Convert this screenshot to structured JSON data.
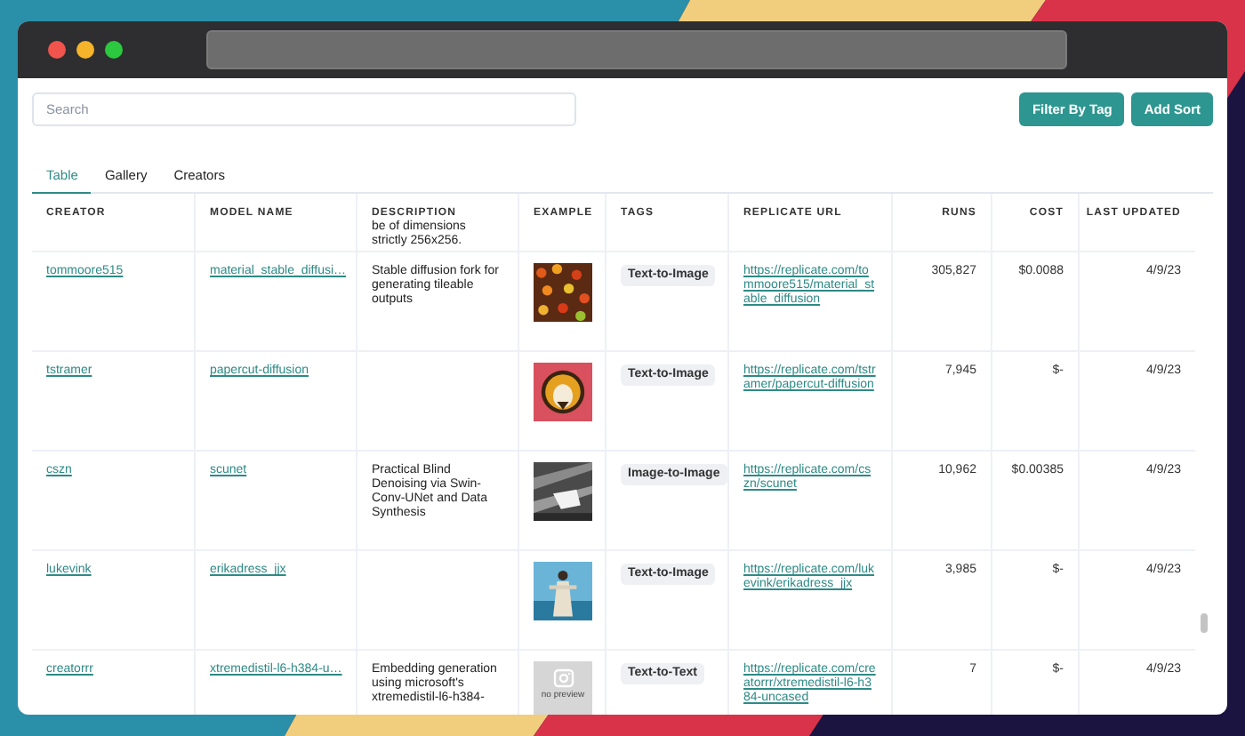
{
  "search": {
    "placeholder": "Search"
  },
  "buttons": [
    "Filter By Tag",
    "Add Sort"
  ],
  "tabs": [
    {
      "label": "Table",
      "selected": true
    },
    {
      "label": "Gallery",
      "selected": false
    },
    {
      "label": "Creators",
      "selected": false
    }
  ],
  "table": {
    "columns": [
      {
        "label": "CREATOR"
      },
      {
        "label": "MODEL NAME"
      },
      {
        "label": "DESCRIPTION",
        "overflow_text": "be of dimensions strictly 256x256."
      },
      {
        "label": "EXAMPLE"
      },
      {
        "label": "TAGS"
      },
      {
        "label": "REPLICATE URL"
      },
      {
        "label": "RUNS"
      },
      {
        "label": "COST"
      },
      {
        "label": "LAST UPDATED"
      }
    ],
    "rows": [
      {
        "creator": "tommoore515",
        "model": "material_stable_diffusi…",
        "description": "Stable diffusion fork for generating tileable outputs",
        "tag": "Text-to-Image",
        "url": "https://replicate.com/tommoore515/material_stable_diffusion",
        "runs": "305,827",
        "cost": "$0.0088",
        "updated": "4/9/23"
      },
      {
        "creator": "tstramer",
        "model": "papercut-diffusion",
        "tag": "Text-to-Image",
        "url": "https://replicate.com/tstramer/papercut-diffusion",
        "runs": "7,945",
        "cost": "$-",
        "updated": "4/9/23"
      },
      {
        "creator": "cszn",
        "model": "scunet",
        "description": "Practical Blind Denoising via Swin-Conv-UNet and Data Synthesis",
        "tag": "Image-to-Image",
        "url": "https://replicate.com/cszn/scunet",
        "runs": "10,962",
        "cost": "$0.00385",
        "updated": "4/9/23"
      },
      {
        "creator": "lukevink",
        "model": "erikadress_jjx",
        "tag": "Text-to-Image",
        "url": "https://replicate.com/lukevink/erikadress_jjx",
        "runs": "3,985",
        "cost": "$-",
        "updated": "4/9/23"
      },
      {
        "creator": "creatorrr",
        "model": "xtremedistil-l6-h384-u…",
        "description": "Embedding generation using microsoft's xtremedistil-l6-h384-",
        "example": {
          "kind": "placeholder",
          "text": "no preview"
        },
        "tag": "Text-to-Text",
        "url": "https://replicate.com/creatorrr/xtremedistil-l6-h384-uncased",
        "runs": "7",
        "cost": "$-",
        "updated": "4/9/23"
      }
    ]
  }
}
